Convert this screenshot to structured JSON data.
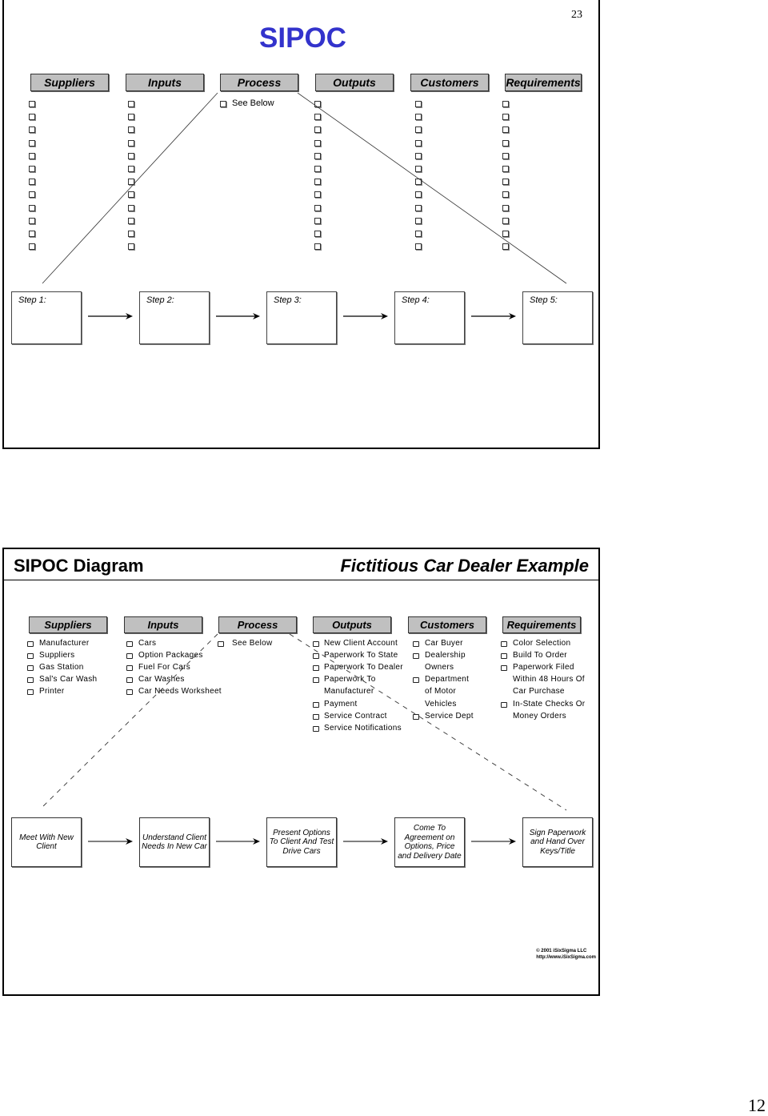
{
  "slide1": {
    "page_number": "23",
    "title": "SIPOC",
    "title_color": "#3333cc",
    "headers": [
      "Suppliers",
      "Inputs",
      "Process",
      "Outputs",
      "Customers",
      "Requirements"
    ],
    "process_item": "See Below",
    "bullets_per_column": 12,
    "steps": [
      "Step 1:",
      "Step 2:",
      "Step 3:",
      "Step 4:",
      "Step 5:"
    ]
  },
  "slide2": {
    "title_left": "SIPOC Diagram",
    "title_right": "Fictitious Car Dealer Example",
    "headers": [
      "Suppliers",
      "Inputs",
      "Process",
      "Outputs",
      "Customers",
      "Requirements"
    ],
    "suppliers": [
      "Manufacturer",
      "Suppliers",
      "Gas Station",
      "Sal's Car Wash",
      "Printer"
    ],
    "inputs": [
      "Cars",
      "Option Packages",
      "Fuel For Cars",
      "Car Washes",
      "Car Needs Worksheet"
    ],
    "process": [
      "See Below"
    ],
    "outputs": [
      {
        "lines": [
          "New Client Account"
        ]
      },
      {
        "lines": [
          "Paperwork To State"
        ]
      },
      {
        "lines": [
          "Paperwork To Dealer"
        ]
      },
      {
        "lines": [
          "Paperwork To",
          "Manufacturer"
        ]
      },
      {
        "lines": [
          "Payment"
        ]
      },
      {
        "lines": [
          "Service Contract"
        ]
      },
      {
        "lines": [
          "Service Notifications"
        ]
      }
    ],
    "customers": [
      {
        "lines": [
          "Car Buyer"
        ]
      },
      {
        "lines": [
          "Dealership",
          "Owners"
        ]
      },
      {
        "lines": [
          "Department",
          "of Motor",
          "Vehicles"
        ]
      },
      {
        "lines": [
          "Service Dept"
        ]
      }
    ],
    "requirements": [
      {
        "lines": [
          "Color Selection"
        ]
      },
      {
        "lines": [
          "Build To Order"
        ]
      },
      {
        "lines": [
          "Paperwork Filed",
          "Within 48 Hours Of",
          "Car Purchase"
        ]
      },
      {
        "lines": [
          "In-State Checks Or",
          "Money Orders"
        ]
      }
    ],
    "process_steps": [
      "Meet With New Client",
      "Understand Client Needs In New Car",
      "Present Options To Client And Test Drive Cars",
      "Come To Agreement on Options, Price and Delivery Date",
      "Sign Paperwork and Hand Over Keys/Title"
    ],
    "copyright_line1": "© 2001 iSixSigma LLC",
    "copyright_line2": "http://www.iSixSigma.com"
  },
  "document_page_number": "12"
}
